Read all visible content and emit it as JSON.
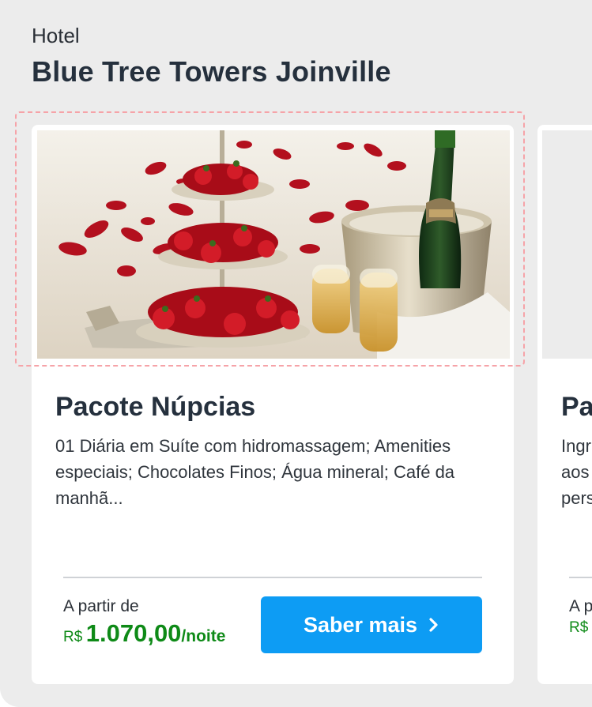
{
  "header": {
    "eyebrow": "Hotel",
    "hotel_name": "Blue Tree Towers Joinville"
  },
  "packages": [
    {
      "title": "Pacote Núpcias",
      "description": "01 Diária em Suíte com hidromassagem; Amenities especiais; Chocolates Finos; Água mineral; Café da manhã...",
      "price_prefix": "A partir de",
      "currency": "R$",
      "price": "1.070,00",
      "price_unit": "/noite",
      "cta_label": "Saber mais",
      "cta_icon": "chevron-right-icon"
    },
    {
      "title": "Pa",
      "description_lines": [
        "Ingr",
        "aos",
        "pers"
      ],
      "price_prefix": "A p",
      "currency": "R$"
    }
  ],
  "colors": {
    "accent": "#0d9cf4",
    "price": "#0e8a17",
    "title": "#25303d",
    "panel": "#ececec",
    "focus_outline": "#f6a3a8"
  }
}
